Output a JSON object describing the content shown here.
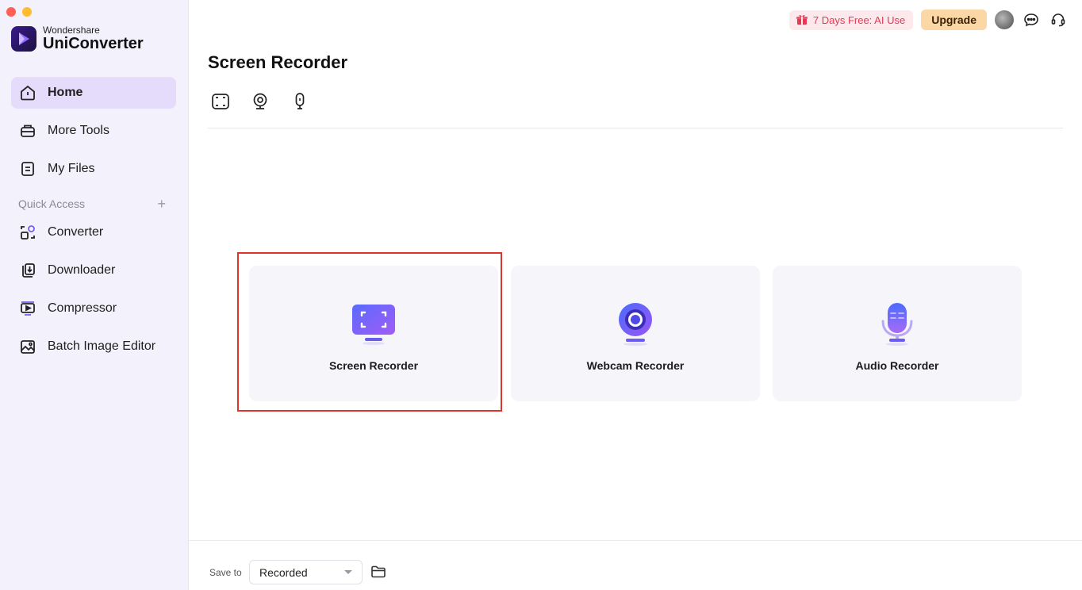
{
  "brand": {
    "small": "Wondershare",
    "big": "UniConverter"
  },
  "sidebar": {
    "items": [
      {
        "label": "Home",
        "icon": "home-icon",
        "active": true
      },
      {
        "label": "More Tools",
        "icon": "toolbox-icon"
      },
      {
        "label": "My Files",
        "icon": "file-icon"
      }
    ],
    "quick_access_label": "Quick Access",
    "quick_items": [
      {
        "label": "Converter",
        "icon": "converter-icon"
      },
      {
        "label": "Downloader",
        "icon": "downloader-icon"
      },
      {
        "label": "Compressor",
        "icon": "compressor-icon"
      },
      {
        "label": "Batch Image Editor",
        "icon": "image-editor-icon"
      }
    ]
  },
  "topbar": {
    "promo": "7 Days Free: AI Use",
    "upgrade": "Upgrade"
  },
  "main": {
    "title": "Screen Recorder",
    "mode_tabs": [
      "screen-capture-icon",
      "webcam-icon",
      "microphone-icon"
    ],
    "cards": [
      {
        "label": "Screen Recorder",
        "icon": "screen-recorder-icon"
      },
      {
        "label": "Webcam Recorder",
        "icon": "webcam-recorder-icon"
      },
      {
        "label": "Audio Recorder",
        "icon": "audio-recorder-icon"
      }
    ]
  },
  "footer": {
    "save_to_label": "Save to",
    "save_to_value": "Recorded"
  },
  "colors": {
    "accent": "#6b4ef0",
    "highlight": "#e0332a",
    "promo_text": "#e23a55",
    "upgrade_bg": "#fcd7a6"
  }
}
